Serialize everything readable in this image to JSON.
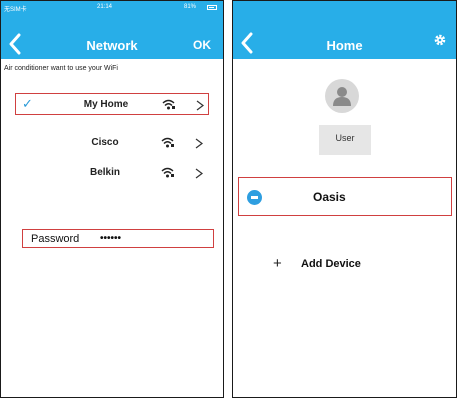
{
  "colors": {
    "accent": "#28aee8",
    "highlight": "#d04040",
    "device": "#2e9ee0"
  },
  "status_bar": {
    "carrier": "无SIM卡",
    "time": "21:14",
    "battery": "81%"
  },
  "network_screen": {
    "title": "Network",
    "ok_label": "OK",
    "back_icon": "chevron-left-icon",
    "prompt": "Air conditioner want to use your WiFi",
    "networks": [
      {
        "name": "My Home",
        "selected": true,
        "check": "✓"
      },
      {
        "name": "Cisco",
        "selected": false,
        "check": ""
      },
      {
        "name": "Belkin",
        "selected": false,
        "check": ""
      }
    ],
    "password": {
      "label": "Password",
      "value": "••••••"
    }
  },
  "home_screen": {
    "title": "Home",
    "settings_icon": "gear-icon",
    "user_label": "User",
    "device": {
      "name": "Oasis",
      "icon": "ac-device-icon"
    },
    "add_device": {
      "icon_glyph": "+",
      "label": "Add Device"
    }
  }
}
